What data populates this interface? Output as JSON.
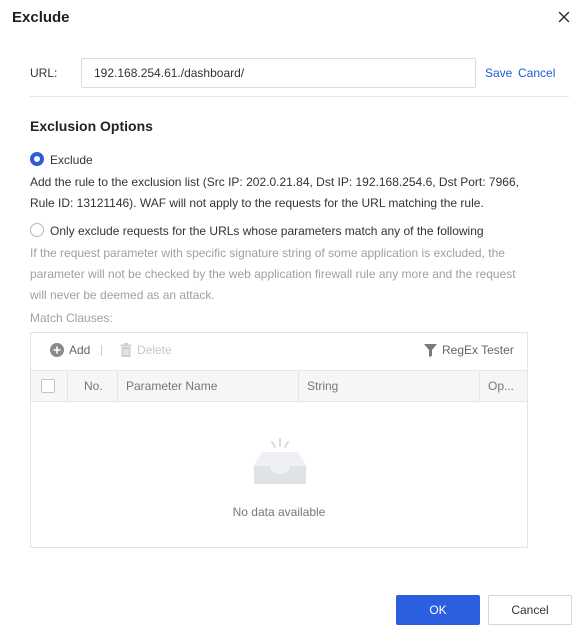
{
  "dialog": {
    "title": "Exclude"
  },
  "url_row": {
    "label": "URL:",
    "value": "192.168.254.61./dashboard/",
    "save_label": "Save",
    "cancel_label": "Cancel"
  },
  "exclusion": {
    "section_title": "Exclusion Options",
    "options": [
      {
        "label": "Exclude",
        "selected": true,
        "description": "Add the rule to the exclusion list (Src IP: 202.0.21.84, Dst IP: 192.168.254.6, Dst Port: 7966, Rule ID: 13121146). WAF will not apply to the requests for the URL matching the rule."
      },
      {
        "label": "Only exclude requests for the URLs whose parameters match any of the following",
        "selected": false,
        "description": "If the request parameter with specific signature string of some application is excluded, the parameter will not be checked by the web application firewall rule any more and the request will never be deemed as an attack."
      }
    ]
  },
  "match_clauses": {
    "label": "Match Clauses:",
    "toolbar": {
      "add_label": "Add",
      "delete_label": "Delete",
      "regex_label": "RegEx Tester"
    },
    "columns": [
      "No.",
      "Parameter Name",
      "String",
      "Op..."
    ],
    "empty_text": "No data available"
  },
  "footer": {
    "ok_label": "OK",
    "cancel_label": "Cancel"
  },
  "colors": {
    "primary": "#2b5fe0",
    "link": "#1f5bd8",
    "disabled_text": "#a0a0a0"
  },
  "icons": [
    "close-icon",
    "plus-circle-icon",
    "trash-icon",
    "filter-icon",
    "empty-inbox-icon"
  ]
}
